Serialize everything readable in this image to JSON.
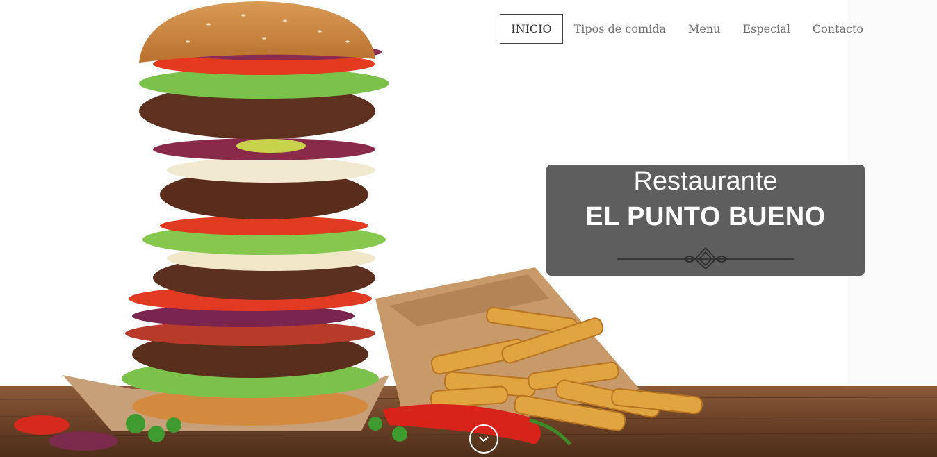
{
  "nav": {
    "items": [
      {
        "label": "INICIO",
        "active": true
      },
      {
        "label": "Tipos de comida",
        "active": false
      },
      {
        "label": "Menu",
        "active": false
      },
      {
        "label": "Especial",
        "active": false
      },
      {
        "label": "Contacto",
        "active": false
      }
    ]
  },
  "hero": {
    "title_line1": "Restaurante",
    "title_line2": "EL PUNTO BUENO",
    "ornament_icon": "ornament-divider-icon",
    "scroll_icon": "chevron-down-icon",
    "image": "burger-and-fries-photo"
  },
  "colors": {
    "card_bg": "#4c4c4c",
    "nav_text": "#6f6f6f",
    "active_border": "#444444"
  }
}
